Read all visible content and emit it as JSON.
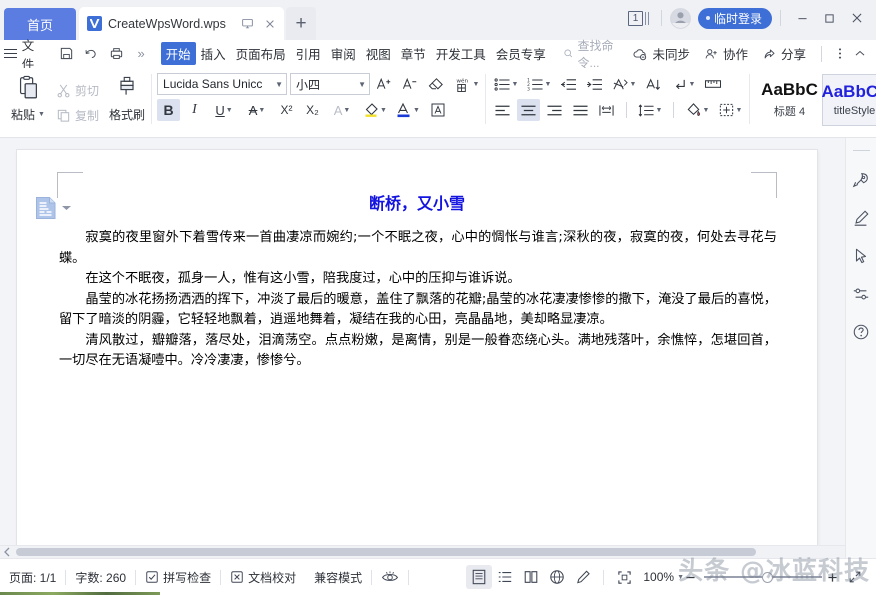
{
  "titlebar": {
    "home_tab": "首页",
    "doc_tab": "CreateWpsWord.wps",
    "new_tab": "+",
    "badge_count": "1",
    "login_button": "临时登录",
    "minimize": "—",
    "maximize": "▢",
    "close": "✕"
  },
  "menubar": {
    "file": "文件",
    "search_placeholder": "查找命令...",
    "tabs": [
      {
        "label": "开始",
        "active": true
      },
      {
        "label": "插入",
        "active": false
      },
      {
        "label": "页面布局",
        "active": false
      },
      {
        "label": "引用",
        "active": false
      },
      {
        "label": "审阅",
        "active": false
      },
      {
        "label": "视图",
        "active": false
      },
      {
        "label": "章节",
        "active": false
      },
      {
        "label": "开发工具",
        "active": false
      },
      {
        "label": "会员专享",
        "active": false
      }
    ],
    "overflow": "»",
    "right_items": [
      {
        "label": "未同步",
        "icon": "cloud-sync-icon"
      },
      {
        "label": "协作",
        "icon": "collaborate-icon"
      },
      {
        "label": "分享",
        "icon": "share-icon"
      }
    ],
    "more": "⋮",
    "collapse": "⌃"
  },
  "ribbon": {
    "clipboard": {
      "paste": "粘贴",
      "cut": "剪切",
      "copy": "复制",
      "format_painter": "格式刷"
    },
    "font": {
      "family": "Lucida Sans Unicc",
      "size": "小四",
      "grow": "A⁺",
      "shrink": "A⁻",
      "clear_format": "clear-format-icon",
      "pinyin": "拼音指南",
      "bold": "B",
      "italic": "I",
      "underline": "U",
      "strikethrough": "A",
      "superscript": "X²",
      "subscript": "X₂",
      "text_effect": "A",
      "highlight": "highlight-icon",
      "font_color": "A",
      "char_border": "A"
    },
    "paragraph": {
      "bullets": "bullets-icon",
      "numbering": "numbering-icon",
      "decrease_indent": "decrease-indent-icon",
      "increase_indent": "increase-indent-icon",
      "smart_layout": "smart-layout-icon",
      "sort": "sort-icon",
      "show_marks": "show-marks-icon",
      "ruler": "ruler-icon",
      "align_left": "align-left-icon",
      "align_center": "align-center-icon",
      "align_right": "align-right-icon",
      "justify": "justify-icon",
      "distribute": "distribute-icon",
      "line_spacing": "line-spacing-icon",
      "shading": "shading-icon",
      "borders": "borders-icon"
    },
    "styles": [
      {
        "preview": "AaBbC",
        "name": "标题 4",
        "selected": false,
        "color": "#111111"
      },
      {
        "preview": "AaBbCc",
        "name": "titleStyle",
        "selected": true,
        "color": "#2222dd"
      }
    ]
  },
  "document": {
    "title": "断桥，又小雪",
    "paragraphs": [
      "寂寞的夜里窗外下着雪传来一首曲凄凉而婉约;一个不眠之夜，心中的惆怅与谁言;深秋的夜，寂寞的夜，何处去寻花与蝶。",
      "在这个不眠夜，孤身一人，惟有这小雪，陪我度过，心中的压抑与谁诉说。",
      "晶莹的冰花扬扬洒洒的挥下，冲淡了最后的暖意，盖住了飘落的花瓣;晶莹的冰花凄凄惨惨的撒下，淹没了最后的喜悦，留下了暗淡的阴霾，它轻轻地飘着，逍遥地舞着，凝结在我的心田，亮晶晶地，美却略显凄凉。",
      "清风散过，瓣瓣落，落尽处，泪滴荡空。点点粉嫩，是离情，别是一般眷恋绕心头。满地残落叶，余憔悴，怎堪回首，一切尽在无语凝噎中。冷冷凄凄，惨惨兮。"
    ],
    "paste_options": "paste-options-icon"
  },
  "rail": {
    "items": [
      {
        "icon": "rocket-icon",
        "name": "rocket"
      },
      {
        "icon": "pen-icon",
        "name": "pen"
      },
      {
        "icon": "cursor-icon",
        "name": "cursor"
      },
      {
        "icon": "sliders-icon",
        "name": "settings"
      },
      {
        "icon": "help-icon",
        "name": "help"
      }
    ]
  },
  "statusbar": {
    "page": "页面: 1/1",
    "word_count": "字数: 260",
    "spell_check": "拼写检查",
    "doc_proof": "文档校对",
    "compat_mode": "兼容模式",
    "eye_icon": "eye-icon",
    "views": [
      {
        "icon": "page-view-icon",
        "active": true
      },
      {
        "icon": "outline-view-icon",
        "active": false
      },
      {
        "icon": "read-view-icon",
        "active": false
      },
      {
        "icon": "web-view-icon",
        "active": false
      },
      {
        "icon": "edit-view-icon",
        "active": false
      }
    ],
    "fit_icon": "fit-page-icon",
    "zoom": "100%",
    "zoom_out": "—",
    "zoom_in": "+",
    "fullscreen": "fullscreen-icon"
  },
  "watermark": "头条 @冰蓝科技",
  "colors": {
    "accent": "#3e6fd6",
    "home_tab": "#5b7ce0",
    "title_text": "#1414e0",
    "chrome_bg": "#f0f1f5"
  }
}
